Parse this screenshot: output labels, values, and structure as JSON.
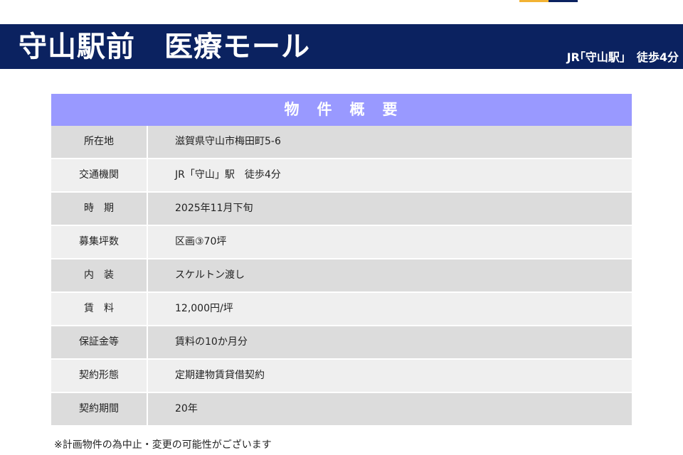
{
  "colors": {
    "banner_bg": "#0b2260",
    "table_header_bg": "#9999ff",
    "row_dark": "#dcdcdc",
    "row_light": "#efefef",
    "top_accent_left": "#f2b233",
    "top_accent_right": "#0b2260"
  },
  "banner": {
    "title": "守山駅前　医療モール",
    "access": "JR｢守山駅｣　徒歩4分"
  },
  "table": {
    "header": "物　件　概　要",
    "rows": [
      {
        "label": "所在地",
        "value": "滋賀県守山市梅田町5-6"
      },
      {
        "label": "交通機関",
        "value": "JR「守山」駅　徒歩4分"
      },
      {
        "label": "時　期",
        "value": "2025年11月下旬"
      },
      {
        "label": "募集坪数",
        "value": "区画③70坪"
      },
      {
        "label": "内　装",
        "value": "スケルトン渡し"
      },
      {
        "label": "賃　料",
        "value": "12,000円/坪"
      },
      {
        "label": "保証金等",
        "value": "賃料の10か月分"
      },
      {
        "label": "契約形態",
        "value": "定期建物賃貸借契約"
      },
      {
        "label": "契約期間",
        "value": "20年"
      }
    ]
  },
  "note": "※計画物件の為中止・変更の可能性がございます"
}
